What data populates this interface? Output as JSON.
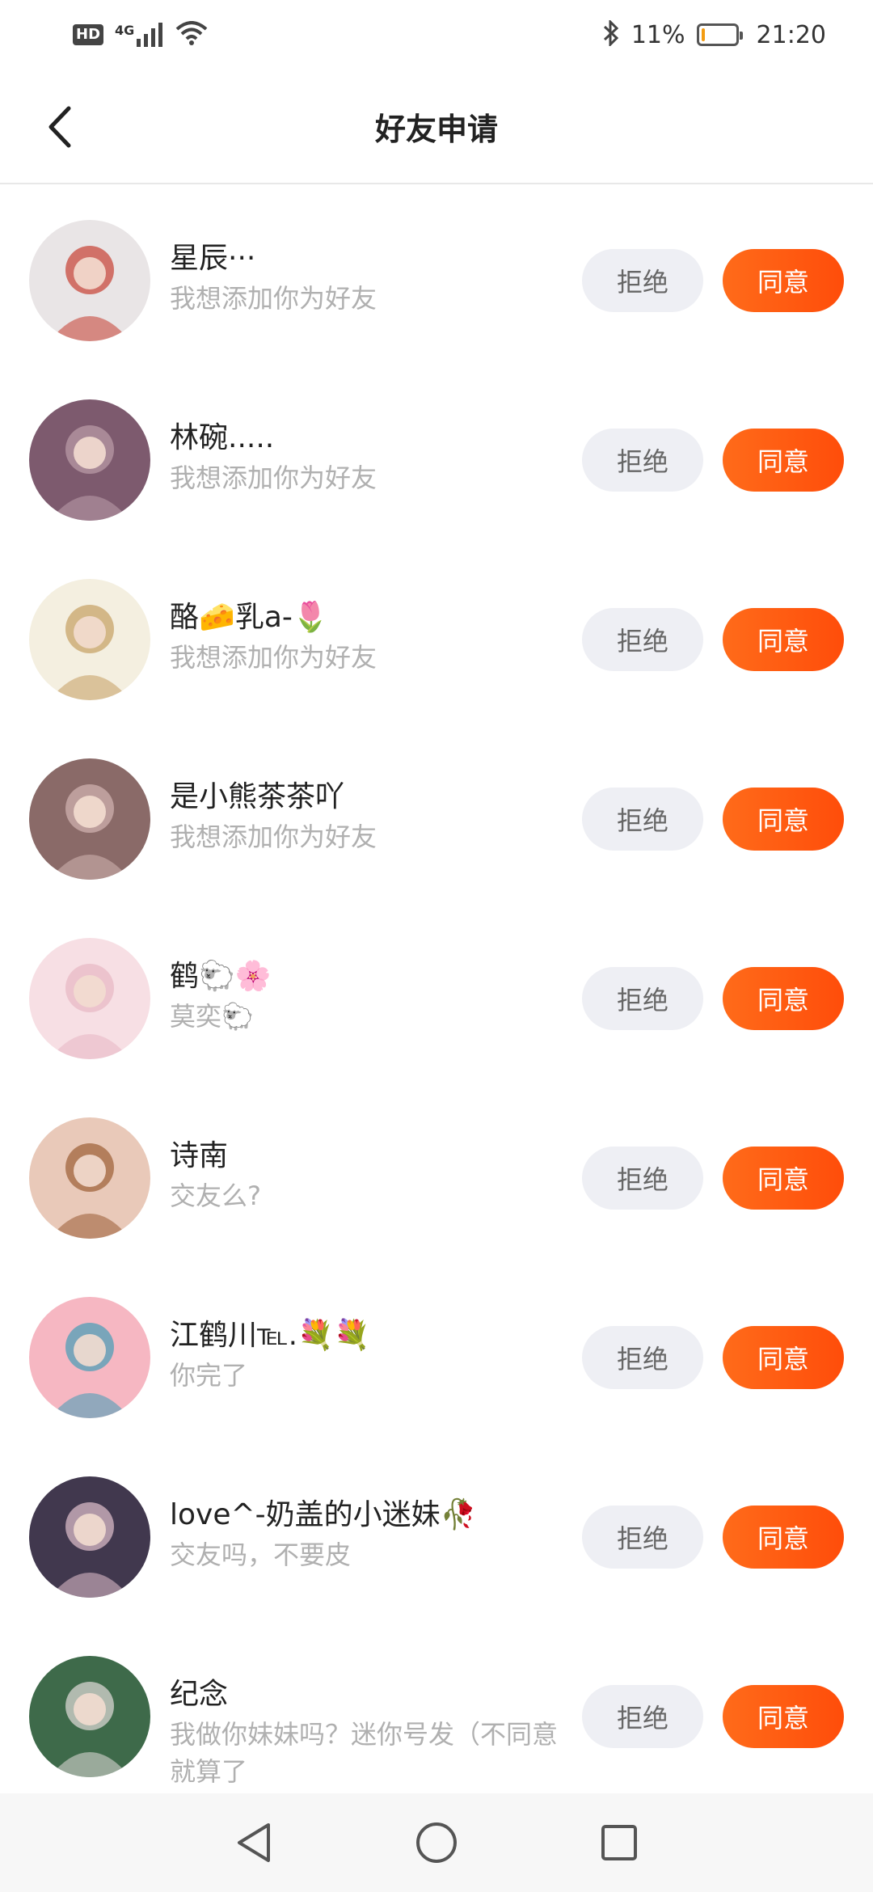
{
  "status_bar": {
    "hd": "HD",
    "network": "4G",
    "battery": "11%",
    "battery_level": 0.11,
    "time": "21:20"
  },
  "header": {
    "title": "好友申请"
  },
  "buttons": {
    "reject": "拒绝",
    "accept": "同意"
  },
  "requests": [
    {
      "name": "星辰···",
      "message": "我想添加你为好友",
      "avatar_colors": [
        "#e9e5e6",
        "#c84a3e"
      ]
    },
    {
      "name": "林碗.....",
      "message": "我想添加你为好友",
      "avatar_colors": [
        "#7d5a6e",
        "#b89aa6"
      ]
    },
    {
      "name": "酪🧀乳a-🌷",
      "message": "我想添加你为好友",
      "avatar_colors": [
        "#f4efe0",
        "#c8a46a"
      ]
    },
    {
      "name": "是小熊茶茶吖",
      "message": "我想添加你为好友",
      "avatar_colors": [
        "#8a6a68",
        "#cdb0ae"
      ]
    },
    {
      "name": "鹤🐑🌸",
      "message": "莫奕🐑",
      "avatar_colors": [
        "#f7dfe4",
        "#e8b9c6"
      ]
    },
    {
      "name": "诗南",
      "message": "交友么?",
      "avatar_colors": [
        "#e9c9b9",
        "#a0643e"
      ]
    },
    {
      "name": "江鹤川℡.💐💐",
      "message": "你完了",
      "avatar_colors": [
        "#f6b7c2",
        "#4f9fb7"
      ]
    },
    {
      "name": "love^-奶盖的小迷妹🥀",
      "message": "交友吗，不要皮",
      "avatar_colors": [
        "#41384e",
        "#d7b8c5"
      ]
    },
    {
      "name": "纪念",
      "message": "我做你妹妹吗？迷你号发（不同意就算了",
      "avatar_colors": [
        "#3e6a4a",
        "#d8d6d2"
      ]
    }
  ]
}
